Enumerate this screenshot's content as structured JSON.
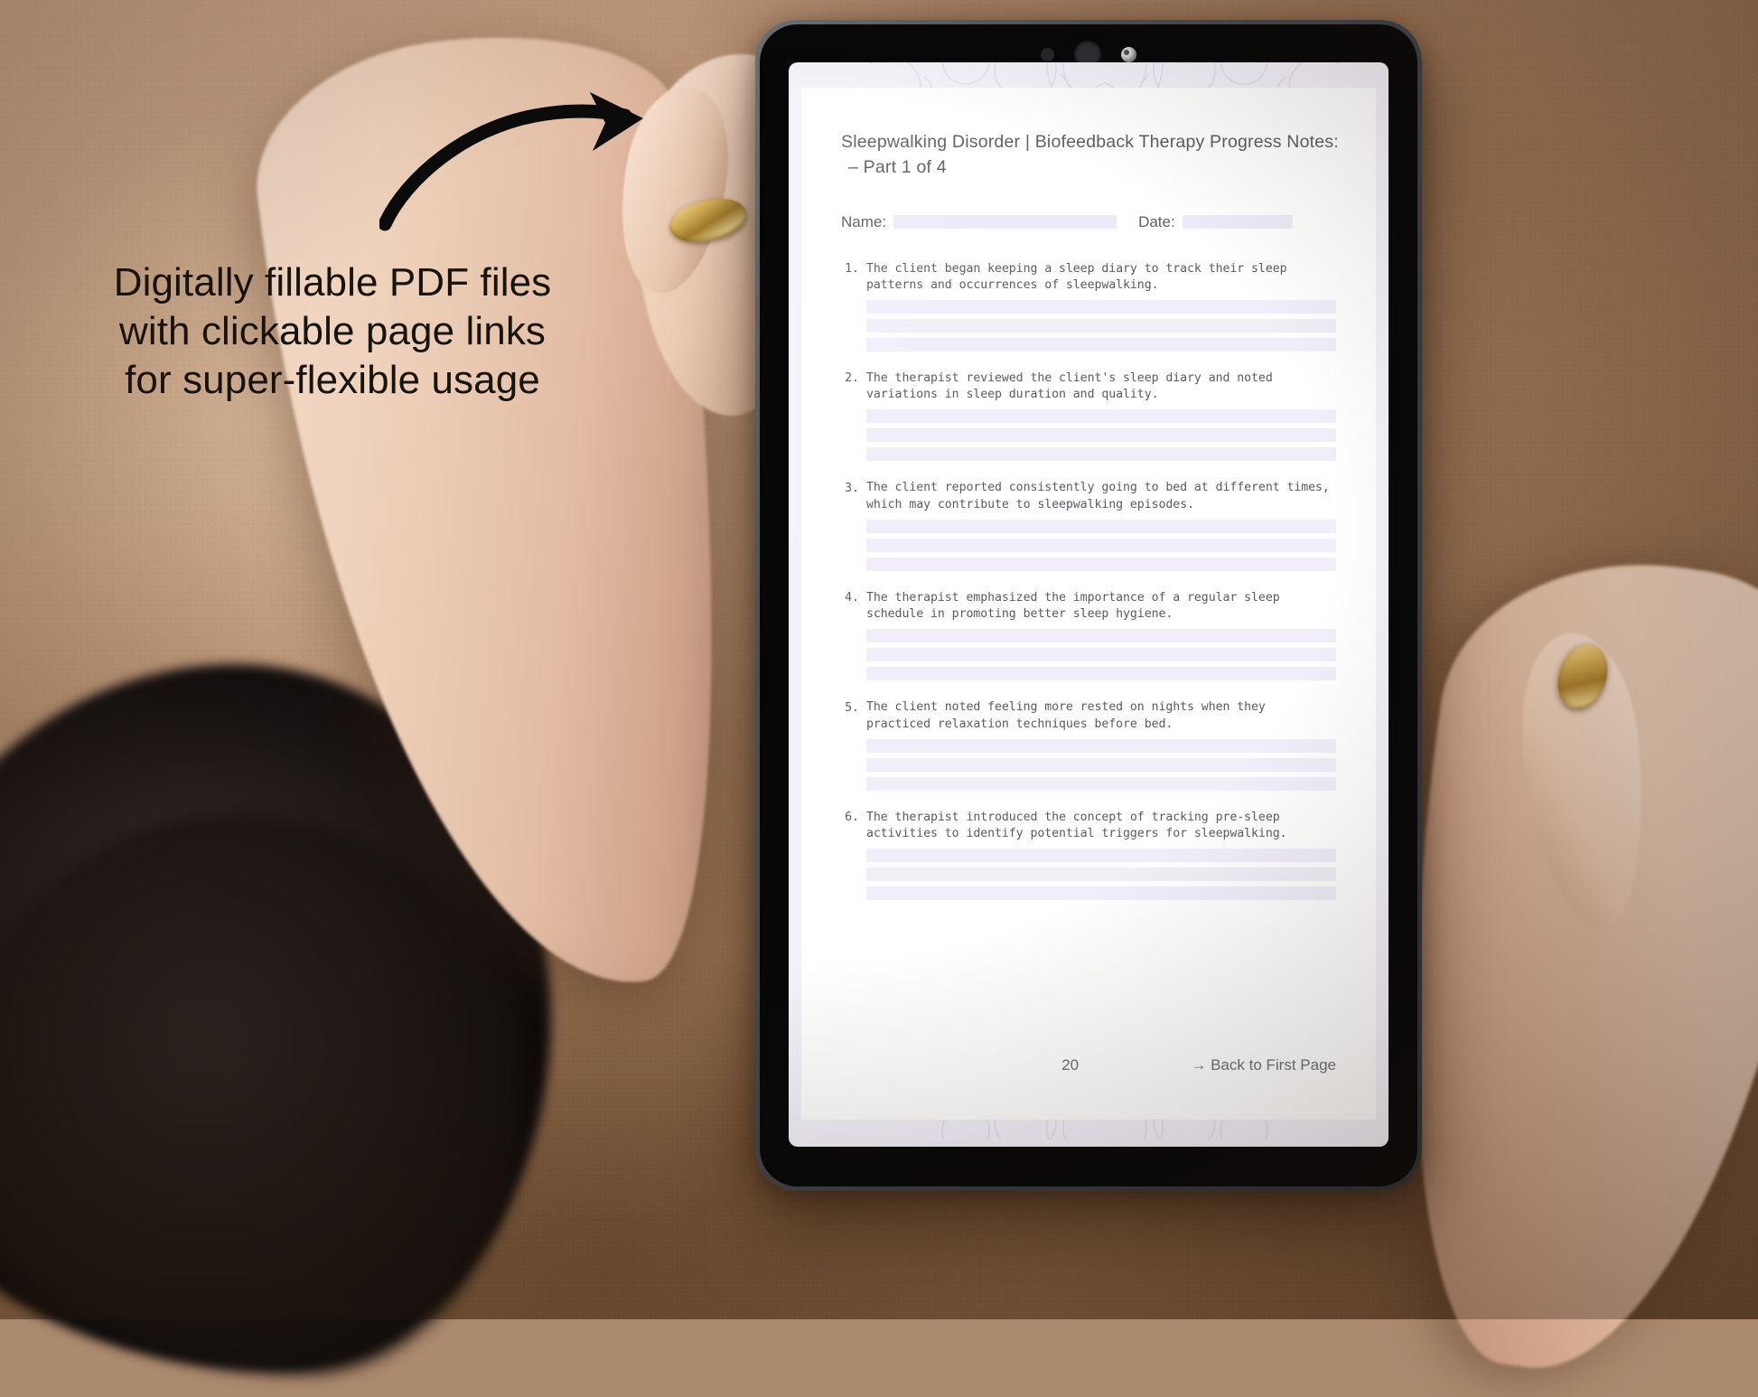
{
  "promo": {
    "headline_lines": [
      "Digitally fillable PDF files",
      "with clickable page links",
      "for super-flexible usage"
    ],
    "arrow_icon": "curved-arrow-right-icon"
  },
  "device": {
    "type": "tablet",
    "frame_color": "#3b3f44",
    "bezel_color": "#070708",
    "camera_icons": [
      "sensor-dot-icon",
      "speaker-dot-icon",
      "front-camera-icon"
    ]
  },
  "document": {
    "background_color": "#f4f1fa",
    "page_color": "#ffffff",
    "field_color": "#eeeaf8",
    "title": "Sleepwalking Disorder | Biofeedback Therapy Progress Notes:",
    "subtitle": "– Part 1 of 4",
    "fields": {
      "name_label": "Name:",
      "name_value": "",
      "name_placeholder": "",
      "date_label": "Date:",
      "date_value": "",
      "date_placeholder": ""
    },
    "items": [
      {
        "number": "1.",
        "text": "The client began keeping a sleep diary to track their sleep patterns and occurrences of sleepwalking.",
        "answer_lines": 3
      },
      {
        "number": "2.",
        "text": "The therapist reviewed the client's sleep diary and noted variations in sleep duration and quality.",
        "answer_lines": 3
      },
      {
        "number": "3.",
        "text": "The client reported consistently going to bed at different times, which may contribute to sleepwalking episodes.",
        "answer_lines": 3
      },
      {
        "number": "4.",
        "text": "The therapist emphasized the importance of a regular sleep schedule in promoting better sleep hygiene.",
        "answer_lines": 3
      },
      {
        "number": "5.",
        "text": "The client noted feeling more rested on nights when they practiced relaxation techniques before bed.",
        "answer_lines": 3
      },
      {
        "number": "6.",
        "text": "The therapist introduced the concept of tracking pre-sleep activities to identify potential triggers for sleepwalking.",
        "answer_lines": 3
      }
    ],
    "footer": {
      "page_number": "20",
      "back_link": "→ Back to First Page"
    }
  }
}
